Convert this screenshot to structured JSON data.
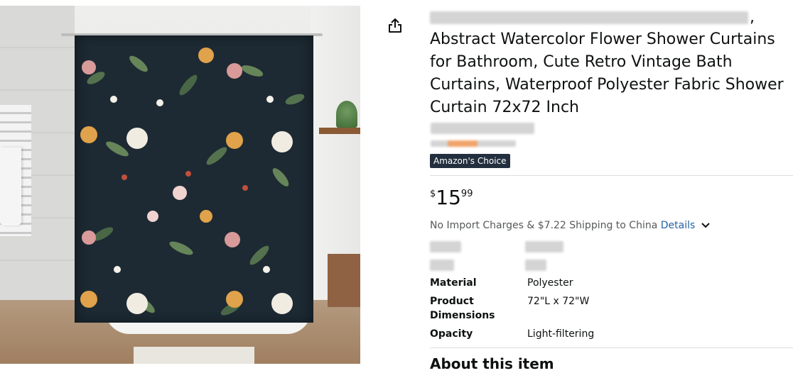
{
  "product": {
    "title": "Abstract Watercolor Flower Shower Curtains for Bathroom, Cute Retro Vintage Bath Curtains, Waterproof Polyester Fabric Shower Curtain 72x72 Inch",
    "title_prefix_punct": ",",
    "badge": "Amazon's Choice",
    "image_alt": "Floral shower curtain product image"
  },
  "price": {
    "symbol": "$",
    "whole": "15",
    "fraction": "99"
  },
  "shipping": {
    "text": "No Import Charges & $7.22 Shipping to China",
    "details_link": "Details"
  },
  "specs": [
    {
      "label": "Material",
      "value": "Polyester"
    },
    {
      "label": "Product Dimensions",
      "value": "72\"L x 72\"W"
    },
    {
      "label": "Opacity",
      "value": "Light-filtering"
    }
  ],
  "about": {
    "heading": "About this item"
  },
  "icons": {
    "share": "share-icon",
    "chevron": "chevron-down-icon"
  },
  "colors": {
    "badge_bg": "#232f3e",
    "link": "#2162a1",
    "curtain_bg": "#1d2a33"
  }
}
